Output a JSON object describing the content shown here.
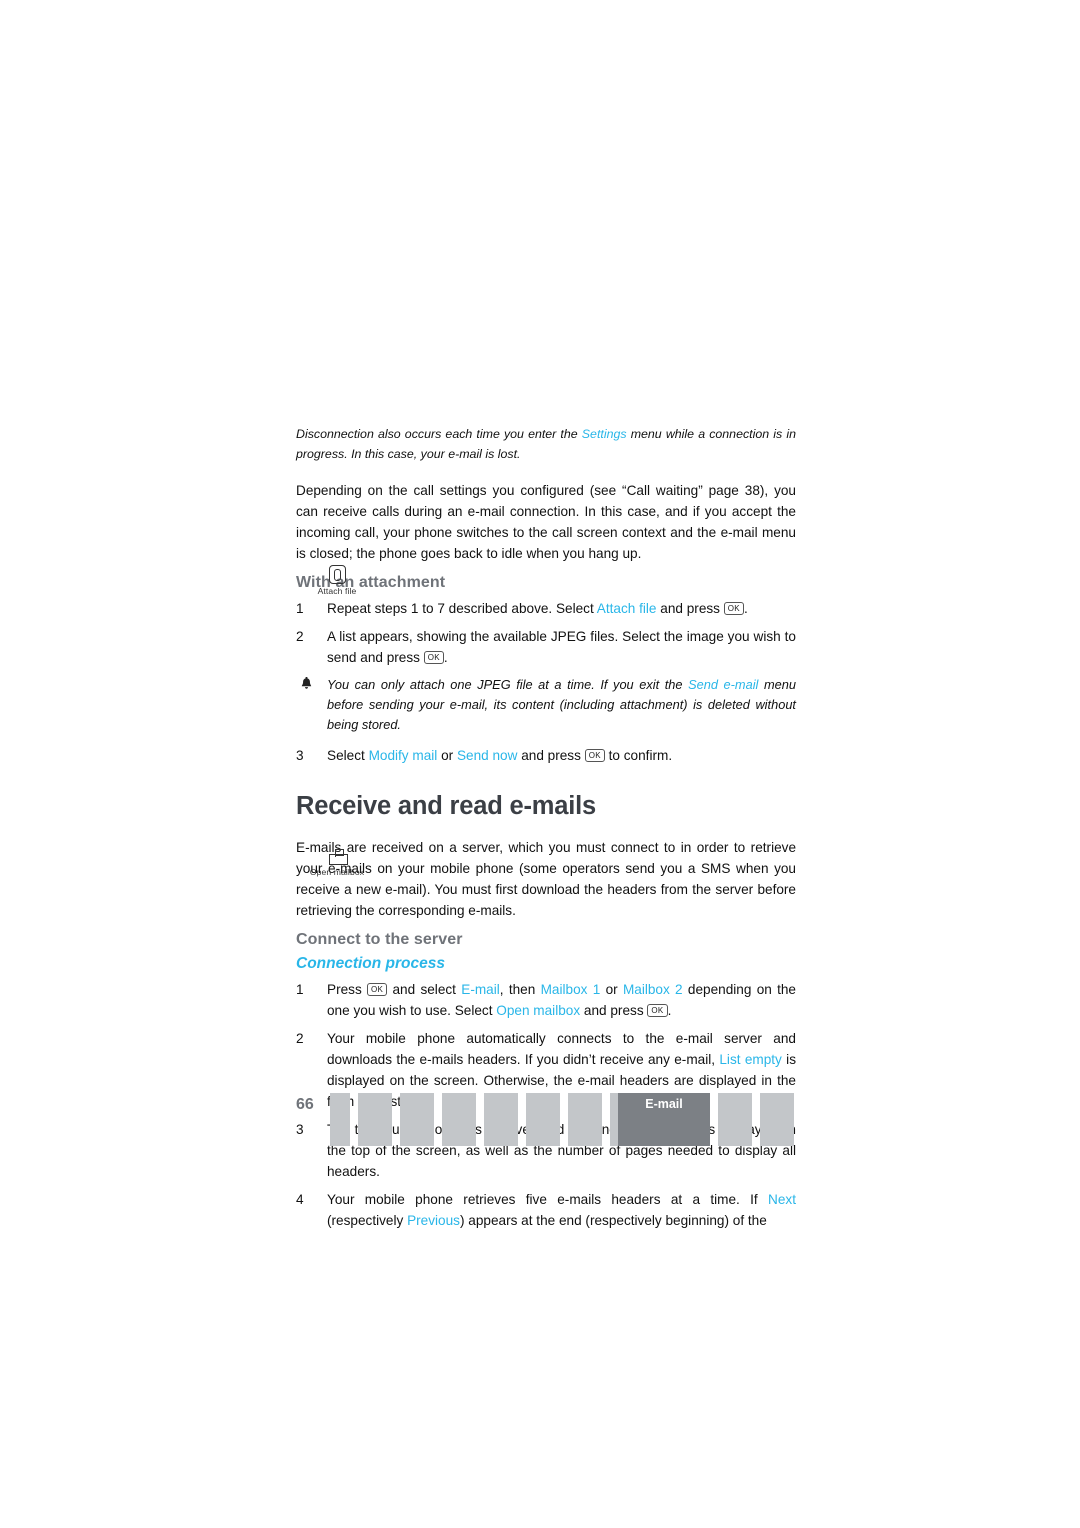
{
  "page": {
    "number": "66",
    "footer_active_label": "E-mail"
  },
  "note_top": {
    "text_1": "Disconnection also occurs each time you enter the ",
    "link_1": "Settings",
    "text_2": " menu while a connection is in progress. In this case, your e-mail is lost."
  },
  "para_calls": "Depending on the call settings you configured (see “Call waiting” page 38), you can receive calls during an e-mail connection. In this case, and if you accept the incoming call, your phone switches to the call screen context and the e-mail menu is closed; the phone goes back to idle when you hang up.",
  "section_attachment": {
    "heading": "With an attachment",
    "margin_icon": {
      "name": "attach-file-icon",
      "caption": "Attach file"
    },
    "steps": [
      {
        "num": "1",
        "t1": "Repeat steps 1 to 7 described above. Select ",
        "link": "Attach file",
        "t2": " and press ",
        "key": "OK",
        "t3": "."
      },
      {
        "num": "2",
        "t1": "A list appears, showing the available JPEG files. Select the image you wish to send and press ",
        "key": "OK",
        "t2": "."
      }
    ],
    "tip": {
      "t1": "You can only attach one JPEG file at a time. If you exit the ",
      "link": "Send e-mail",
      "t2": " menu before sending your e-mail, its content (including attachment) is deleted without being stored."
    },
    "step3": {
      "num": "3",
      "t1": "Select ",
      "link1": "Modify mail",
      "t2": " or ",
      "link2": "Send now",
      "t3": " and press ",
      "key": "OK",
      "t4": " to confirm."
    }
  },
  "section_receive": {
    "heading": "Receive and read e-mails",
    "intro": "E-mails are received on a server, which you must connect to in order to retrieve your e-mails on your mobile phone (some operators send you a SMS when you receive a new e-mail). You must first download the headers from the server before retrieving the corresponding e-mails.",
    "sub_heading": "Connect to the server",
    "italic_heading": "Connection process",
    "margin_icon": {
      "name": "open-mailbox-icon",
      "caption": "Open mailbox"
    },
    "steps": [
      {
        "num": "1",
        "t1": "Press ",
        "key1": "OK",
        "t2": " and select ",
        "link1": "E-mail",
        "t3": ", then ",
        "link2": "Mailbox 1",
        "t4": " or ",
        "link3": "Mailbox 2",
        "t5": " depending on the one you wish to use. Select ",
        "link4": "Open mailbox",
        "t6": " and press ",
        "key2": "OK",
        "t7": "."
      },
      {
        "num": "2",
        "t1": "Your mobile phone automatically connects to the e-mail server and downloads the e-mails headers. If you didn’t receive any e-mail, ",
        "link1": "List empty",
        "t2": " is displayed on the screen. Otherwise, the e-mail headers are displayed in the form of a list."
      },
      {
        "num": "3",
        "t1": "The total number of mails received and pending on the server is displayed on the top of the screen, as well as the number of pages needed to display all headers."
      },
      {
        "num": "4",
        "t1": "Your mobile phone retrieves five e-mails headers at a time. If ",
        "link1": "Next",
        "t2": " (respectively ",
        "link2": "Previous",
        "t3": ") appears at the end (respectively beginning) of the"
      }
    ]
  },
  "colors": {
    "link": "#29b6e8",
    "heading_gray": "#6f7379",
    "title_gray": "#3b3f45",
    "bar": "#c3c6c9",
    "bar_active": "#7c8085"
  }
}
